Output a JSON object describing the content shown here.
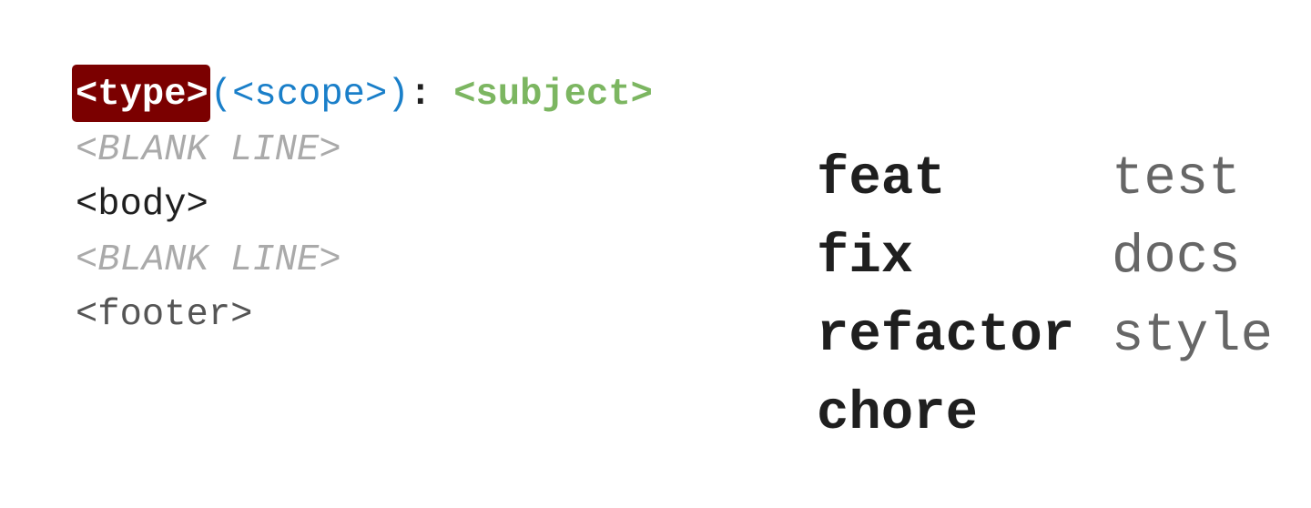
{
  "header_line": {
    "type": "<type>",
    "scope": "(<scope>)",
    "colon": ": ",
    "subject": "<subject>"
  },
  "blank_line_1": "<BLANK LINE>",
  "body": "<body>",
  "blank_line_2": "<BLANK LINE>",
  "footer": "<footer>",
  "commit_types": {
    "primary": [
      "feat",
      "fix",
      "refactor",
      "chore"
    ],
    "secondary": [
      "test",
      "docs",
      "style"
    ]
  },
  "colors": {
    "type_background": "#7b0000",
    "scope": "#1a7fc9",
    "subject": "#7cb661",
    "blank_line": "#aaaaaa"
  }
}
